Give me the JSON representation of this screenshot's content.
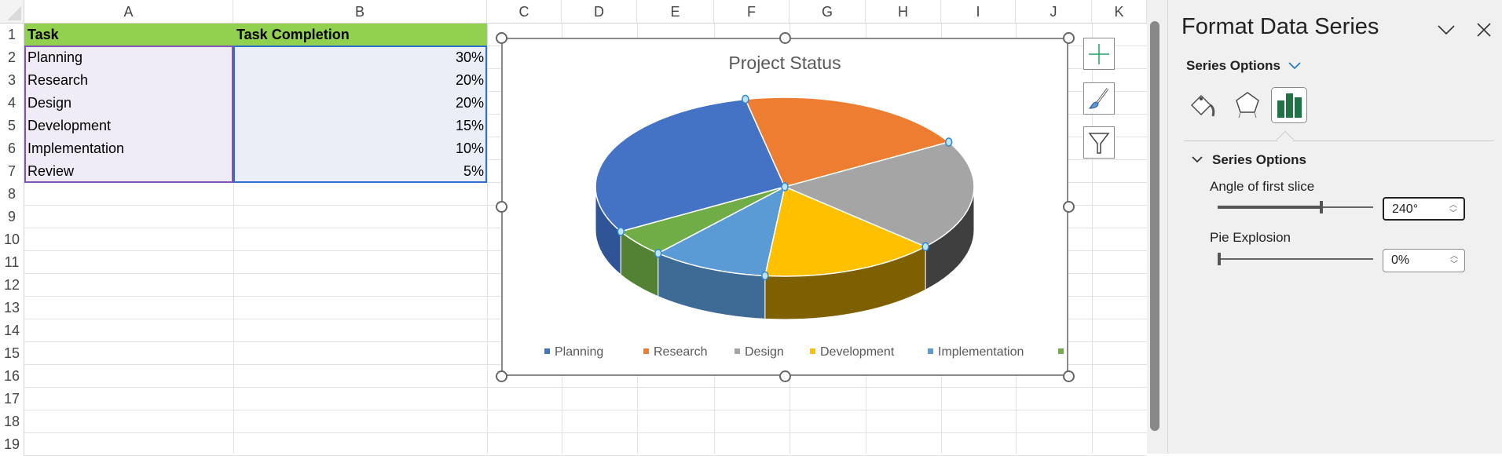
{
  "columns": [
    "A",
    "B",
    "C",
    "D",
    "E",
    "F",
    "G",
    "H",
    "I",
    "J",
    "K"
  ],
  "rows": [
    "1",
    "2",
    "3",
    "4",
    "5",
    "6",
    "7",
    "8",
    "9",
    "10",
    "11",
    "12",
    "13",
    "14",
    "15",
    "16",
    "17",
    "18",
    "19"
  ],
  "table": {
    "headers": [
      "Task",
      "Task Completion"
    ],
    "rows": [
      [
        "Planning",
        "30%"
      ],
      [
        "Research",
        "20%"
      ],
      [
        "Design",
        "20%"
      ],
      [
        "Development",
        "15%"
      ],
      [
        "Implementation",
        "10%"
      ],
      [
        "Review",
        "5%"
      ]
    ]
  },
  "chart_data": {
    "type": "pie",
    "title": "Project Status",
    "categories": [
      "Planning",
      "Research",
      "Design",
      "Development",
      "Implementation",
      "Review"
    ],
    "values": [
      30,
      20,
      20,
      15,
      10,
      5
    ],
    "colors": [
      "#4472c4",
      "#ed7d31",
      "#a5a5a5",
      "#ffc000",
      "#5b9bd5",
      "#70ad47"
    ],
    "side_colors": [
      "#2f5597",
      "#a9561f",
      "#3f3f3f",
      "#7f6000",
      "#3d6b96",
      "#548235"
    ],
    "angle_of_first_slice": 240,
    "legend_position": "bottom",
    "three_d": true
  },
  "chart_buttons": [
    "chart-elements",
    "chart-styles",
    "chart-filters"
  ],
  "panel": {
    "title": "Format Data Series",
    "options_dropdown": "Series Options",
    "section": "Series Options",
    "angle_label": "Angle of first slice",
    "angle_value": "240°",
    "angle_fraction": 0.6667,
    "explosion_label": "Pie Explosion",
    "explosion_value": "0%",
    "explosion_fraction": 0
  }
}
